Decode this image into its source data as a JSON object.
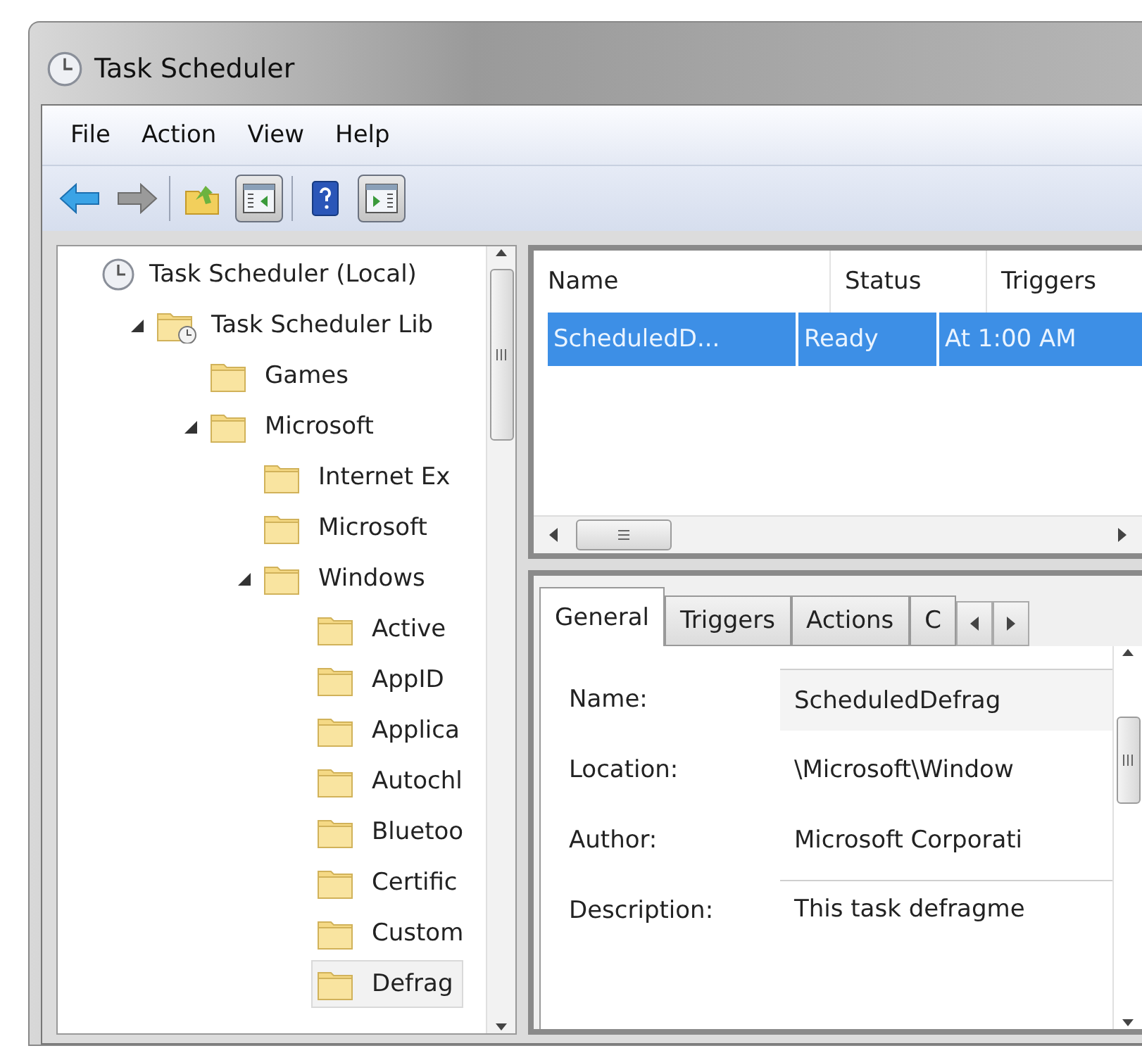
{
  "window": {
    "title": "Task Scheduler"
  },
  "menu": [
    "File",
    "Action",
    "View",
    "Help"
  ],
  "toolbar": [
    {
      "kind": "back",
      "pressed": false
    },
    {
      "kind": "forward",
      "pressed": false
    },
    {
      "kind": "separator"
    },
    {
      "kind": "folder-up",
      "pressed": false
    },
    {
      "kind": "console-tree",
      "pressed": true
    },
    {
      "kind": "separator"
    },
    {
      "kind": "help",
      "pressed": false
    },
    {
      "kind": "action-pane",
      "pressed": true
    }
  ],
  "tree": [
    {
      "label": "Task Scheduler (Local)",
      "kind": "clock",
      "selected": false,
      "children": [
        {
          "label": "Task Scheduler Lib",
          "kind": "library",
          "expanded": true,
          "selected": false,
          "children": [
            {
              "label": "Games",
              "kind": "folder",
              "expanded": false,
              "selected": false
            },
            {
              "label": "Microsoft",
              "kind": "folder",
              "expanded": true,
              "selected": false,
              "children": [
                {
                  "label": "Internet Ex",
                  "kind": "folder",
                  "expanded": false,
                  "selected": false
                },
                {
                  "label": "Microsoft",
                  "kind": "folder",
                  "expanded": false,
                  "selected": false
                },
                {
                  "label": "Windows",
                  "kind": "folder",
                  "expanded": true,
                  "selected": false,
                  "children": [
                    {
                      "label": "Active",
                      "kind": "folder",
                      "expanded": false,
                      "selected": false
                    },
                    {
                      "label": "AppID",
                      "kind": "folder",
                      "expanded": false,
                      "selected": false
                    },
                    {
                      "label": "Applica",
                      "kind": "folder",
                      "expanded": false,
                      "selected": false
                    },
                    {
                      "label": "Autochl",
                      "kind": "folder",
                      "expanded": false,
                      "selected": false
                    },
                    {
                      "label": "Bluetoo",
                      "kind": "folder",
                      "expanded": false,
                      "selected": false
                    },
                    {
                      "label": "Certific",
                      "kind": "folder",
                      "expanded": false,
                      "selected": false
                    },
                    {
                      "label": "Custom",
                      "kind": "folder",
                      "expanded": false,
                      "selected": false
                    },
                    {
                      "label": "Defrag",
                      "kind": "folder",
                      "expanded": false,
                      "selected": true
                    }
                  ]
                }
              ]
            }
          ]
        }
      ]
    }
  ],
  "task_list": {
    "columns": [
      "Name",
      "Status",
      "Triggers"
    ],
    "rows": [
      {
        "cells": [
          "ScheduledD...",
          "Ready",
          "At 1:00 AM"
        ],
        "selected": true
      }
    ]
  },
  "details": {
    "tabs": [
      {
        "label": "General",
        "selected": true
      },
      {
        "label": "Triggers",
        "selected": false
      },
      {
        "label": "Actions",
        "selected": false
      },
      {
        "label": "C",
        "selected": false
      }
    ],
    "fields": [
      {
        "label": "Name:",
        "value": "ScheduledDefrag",
        "kind": "field"
      },
      {
        "label": "Location:",
        "value": "\\Microsoft\\Window",
        "kind": "text"
      },
      {
        "label": "Author:",
        "value": "Microsoft Corporati",
        "kind": "text"
      },
      {
        "label": "Description:",
        "value": "This task defragme",
        "kind": "area"
      }
    ]
  }
}
